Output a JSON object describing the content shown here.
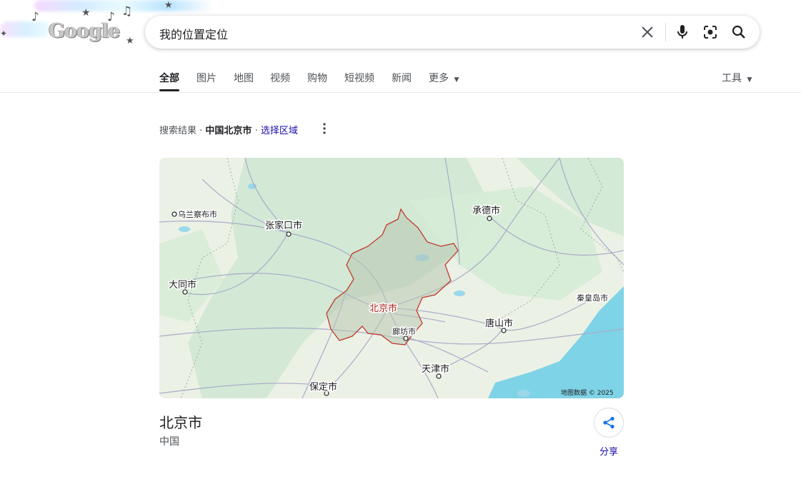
{
  "logo": {
    "text": "Google"
  },
  "search": {
    "query": "我的位置定位"
  },
  "tabs": [
    {
      "label": "全部"
    },
    {
      "label": "图片"
    },
    {
      "label": "地图"
    },
    {
      "label": "视频"
    },
    {
      "label": "购物"
    },
    {
      "label": "短视频"
    },
    {
      "label": "新闻"
    },
    {
      "label": "更多"
    }
  ],
  "tools_label": "工具",
  "location_line": {
    "prefix": "搜索结果",
    "sep": " · ",
    "place": "中国北京市",
    "action": "选择区域"
  },
  "map": {
    "labels": {
      "wulanchabu": "乌兰察布市",
      "zhangjiakou": "张家口市",
      "chengde": "承德市",
      "datong": "大同市",
      "beijing": "北京市",
      "langfang": "廊坊市",
      "tangshan": "唐山市",
      "qinhuangdao": "秦皇岛市",
      "tianjin": "天津市",
      "baoding": "保定市"
    },
    "attribution": "地图数据 © 2025"
  },
  "place": {
    "name": "北京市",
    "country": "中国"
  },
  "share_label": "分享",
  "colors": {
    "link": "#1a0dab",
    "boundary": "#c0392b",
    "water": "#7fd3e6",
    "land": "#ecf1e6",
    "green": "#cfe8d2"
  }
}
